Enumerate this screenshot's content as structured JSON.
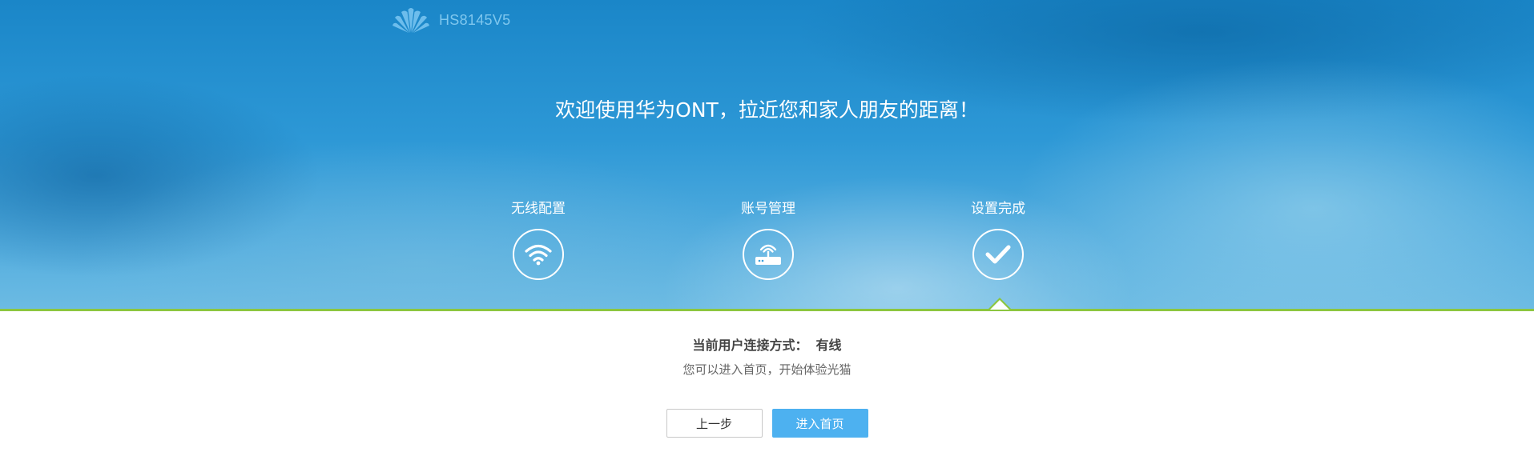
{
  "header": {
    "logo_icon": "huawei-logo-icon",
    "model": "HS8145V5"
  },
  "welcome": {
    "text": "欢迎使用华为ONT，拉近您和家人朋友的距离！"
  },
  "steps": [
    {
      "label": "无线配置",
      "icon": "wifi-icon"
    },
    {
      "label": "账号管理",
      "icon": "router-icon"
    },
    {
      "label": "设置完成",
      "icon": "checkmark-icon"
    }
  ],
  "status": {
    "connection_label": "当前用户连接方式：",
    "connection_value": "有线",
    "hint": "您可以进入首页，开始体验光猫"
  },
  "buttons": {
    "prev_label": "上一步",
    "enter_label": "进入首页"
  },
  "colors": {
    "accent_green": "#8cc63f",
    "primary_button": "#4db1f0",
    "hero_blue": "#1a86c8"
  }
}
